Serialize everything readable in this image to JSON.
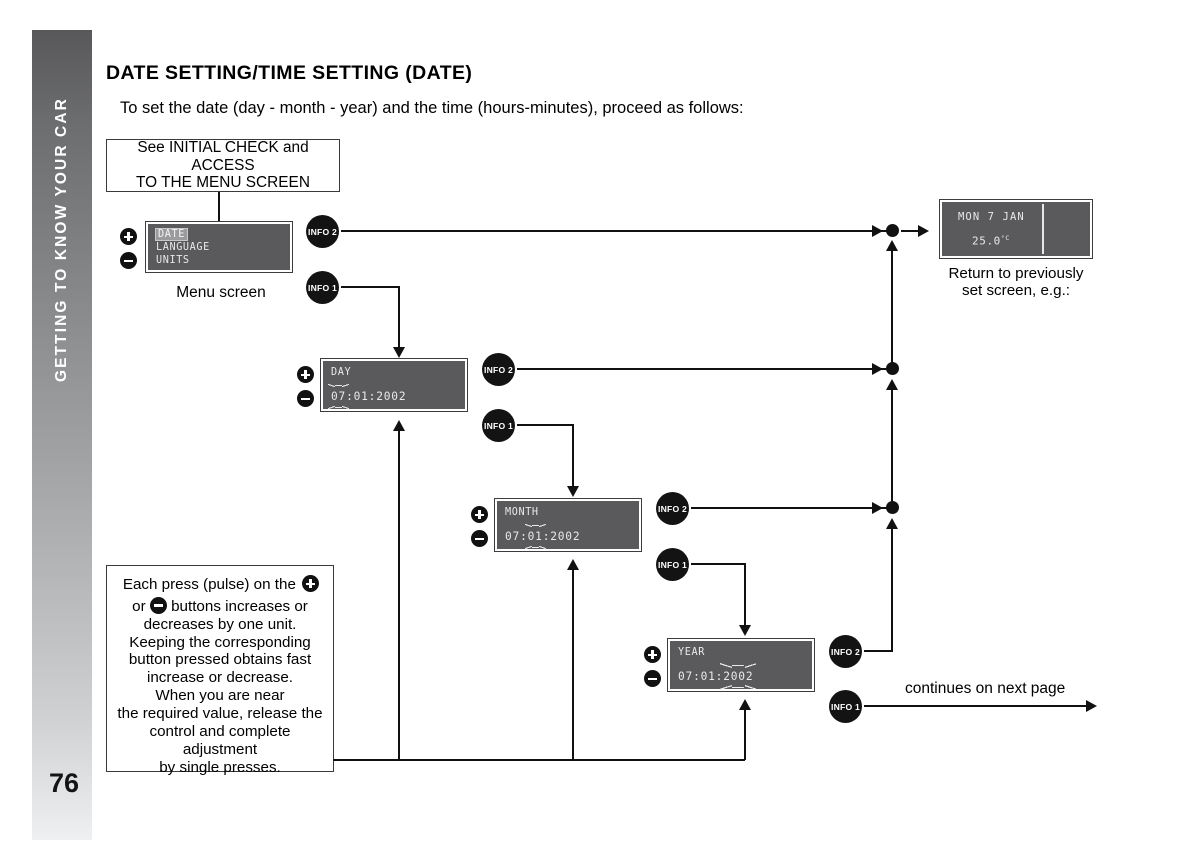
{
  "section_tab": {
    "label": "GETTING TO KNOW YOUR CAR",
    "page_number": "76"
  },
  "heading": {
    "title": "DATE SETTING/TIME SETTING (DATE)",
    "subtitle": "To set the date (day - month - year) and the time (hours-minutes), proceed as follows:"
  },
  "intro_box": {
    "line1": "See INITIAL CHECK and ACCESS",
    "line2": "TO THE MENU SCREEN"
  },
  "menu_screen": {
    "caption": "Menu screen",
    "items": [
      "DATE",
      "LANGUAGE",
      "UNITS"
    ],
    "selected_index": 0
  },
  "clock_screen": {
    "date_line": "MON 7 JAN",
    "temperature": "25.0",
    "temperature_unit": "°C",
    "caption_line1": "Return to previously",
    "caption_line2": "set screen, e.g.:"
  },
  "field_screens": [
    {
      "id": "day",
      "label": "DAY",
      "value_before": "",
      "value_blinking": "07",
      "value_after": ":01:2002"
    },
    {
      "id": "month",
      "label": "MONTH",
      "value_before": "07:",
      "value_blinking": "01",
      "value_after": ":2002"
    },
    {
      "id": "year",
      "label": "YEAR",
      "value_before": "07:01:",
      "value_blinking": "2002",
      "value_after": ""
    }
  ],
  "info_badges": {
    "info1": "INFO 1",
    "info2": "INFO 2"
  },
  "note_box": {
    "lines": [
      "Each press (pulse) on the  ⊕",
      "or  ⊖ buttons increases or",
      "decreases by one unit.",
      "Keeping the corresponding",
      "button pressed obtains fast",
      "increase or decrease.",
      "When you are near",
      "the required value, release the",
      "control and complete adjustment",
      "by single presses."
    ],
    "text": "Each press (pulse) on the ⊕ or ⊖ buttons increases or decreases by one unit. Keeping the corresponding button pressed obtains fast increase or decrease. When you are near the required value, release the control and complete adjustment by single presses."
  },
  "footer": {
    "continues_label": "continues on next page"
  },
  "controls": {
    "plus": "plus-button",
    "minus": "minus-button"
  },
  "colors": {
    "lcd_background": "#5a5a5c",
    "lcd_text": "#e9e9ea",
    "line": "#111111",
    "tab_top": "#58585a",
    "tab_bottom": "#eff0f1"
  }
}
